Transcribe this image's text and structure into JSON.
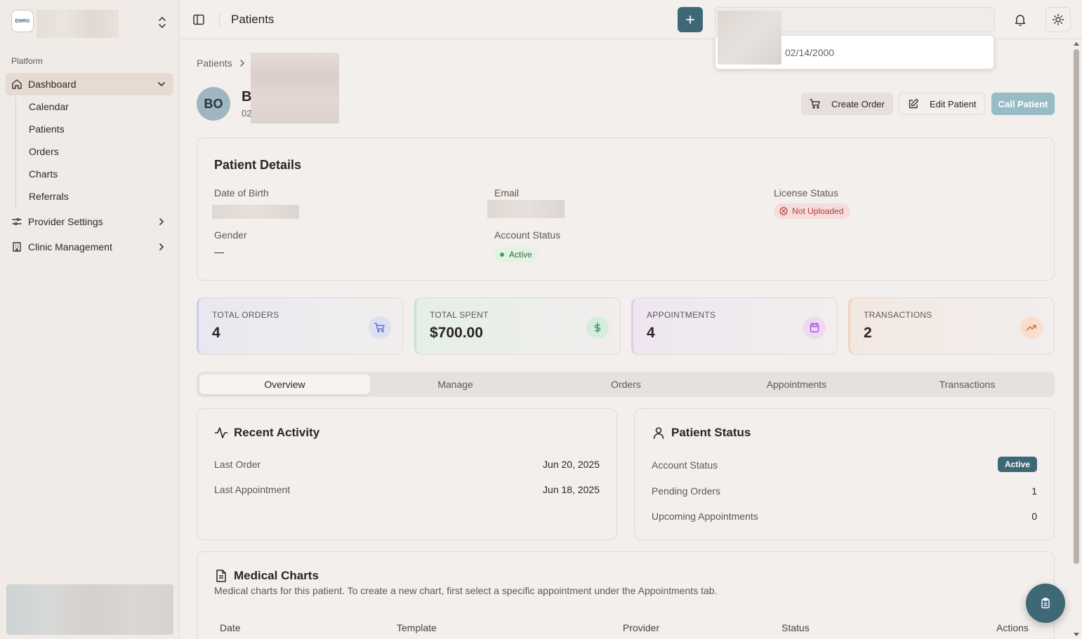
{
  "sidebar": {
    "brand_logo_text": "EMRG",
    "section_label": "Platform",
    "nav": [
      {
        "label": "Dashboard"
      },
      {
        "label": "Provider Settings"
      },
      {
        "label": "Clinic Management"
      }
    ],
    "sub_items": [
      "Calendar",
      "Patients",
      "Orders",
      "Charts",
      "Referrals"
    ]
  },
  "topbar": {
    "title": "Patients",
    "dropdown_date": "02/14/2000"
  },
  "breadcrumb": {
    "root": "Patients"
  },
  "patient": {
    "initials": "BO",
    "name_visible": "B",
    "sub_visible": "02"
  },
  "actions": {
    "create_order": "Create Order",
    "edit_patient": "Edit Patient",
    "call_patient": "Call Patient"
  },
  "details": {
    "title": "Patient Details",
    "dob_label": "Date of Birth",
    "email_label": "Email",
    "license_label": "License Status",
    "license_value": "Not Uploaded",
    "gender_label": "Gender",
    "gender_value": "—",
    "account_label": "Account Status",
    "account_value": "Active"
  },
  "stats": [
    {
      "label": "TOTAL ORDERS",
      "value": "4",
      "icon": "cart-icon",
      "color": "#5b6fd6"
    },
    {
      "label": "TOTAL SPENT",
      "value": "$700.00",
      "icon": "dollar-icon",
      "color": "#2f9a52"
    },
    {
      "label": "APPOINTMENTS",
      "value": "4",
      "icon": "calendar-icon",
      "color": "#a24fd0"
    },
    {
      "label": "TRANSACTIONS",
      "value": "2",
      "icon": "trending-up-icon",
      "color": "#e0702b"
    }
  ],
  "tabs": [
    "Overview",
    "Manage",
    "Orders",
    "Appointments",
    "Transactions"
  ],
  "recent_activity": {
    "title": "Recent Activity",
    "rows": [
      {
        "label": "Last Order",
        "value": "Jun 20, 2025"
      },
      {
        "label": "Last Appointment",
        "value": "Jun 18, 2025"
      }
    ]
  },
  "patient_status": {
    "title": "Patient Status",
    "rows": [
      {
        "label": "Account Status",
        "value": "Active"
      },
      {
        "label": "Pending Orders",
        "value": "1"
      },
      {
        "label": "Upcoming Appointments",
        "value": "0"
      }
    ]
  },
  "medical_charts": {
    "title": "Medical Charts",
    "description": "Medical charts for this patient. To create a new chart, first select a specific appointment under the Appointments tab.",
    "columns": [
      "Date",
      "Template",
      "Provider",
      "Status",
      "Actions"
    ]
  }
}
